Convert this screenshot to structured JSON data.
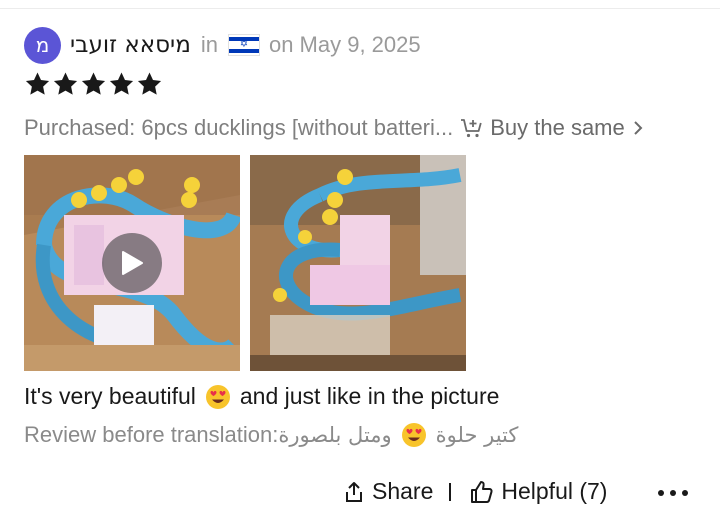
{
  "review": {
    "avatar_letter": "מ",
    "author": "מיסאא זועבי",
    "in_label": "in",
    "country_flag": "israel-flag",
    "date": "on May 9, 2025",
    "rating": 5,
    "purchased": "Purchased: 6pcs ducklings [without batteri...",
    "buy_same_label": "Buy the same",
    "text_before_emoji": "It's very beautiful",
    "text_after_emoji": "and just like in the picture",
    "original_label": "Review before translation:",
    "original_before_emoji": "كتير حلوة",
    "original_after_emoji": "ومتل بلصورة"
  },
  "actions": {
    "share_label": "Share",
    "helpful_label": "Helpful (7)"
  },
  "colors": {
    "avatar_bg": "#5b55d6",
    "star": "#191919",
    "muted_text": "#9a9a9a"
  }
}
